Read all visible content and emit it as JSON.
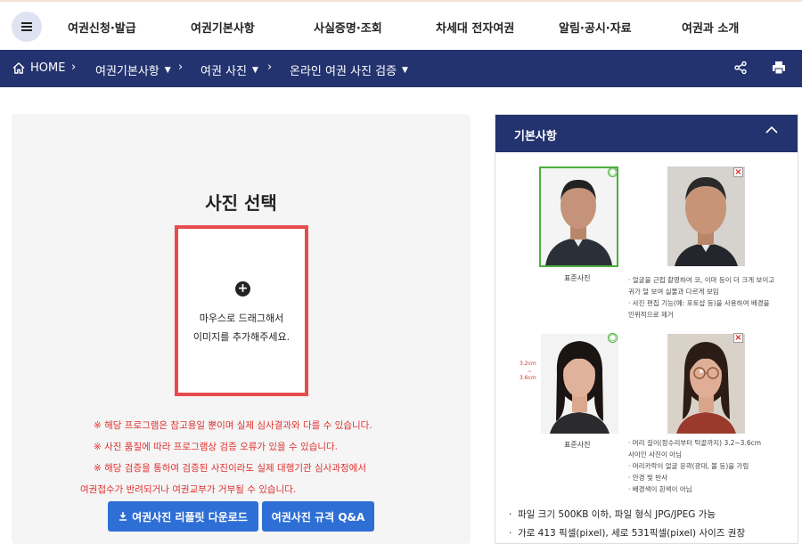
{
  "nav": {
    "menu_icon": "hamburger-icon",
    "items": [
      "여권신청·발급",
      "여권기본사항",
      "사실증명·조회",
      "차세대 전자여권",
      "알림·공시·자료",
      "여권과 소개"
    ]
  },
  "breadcrumb": {
    "home": "HOME",
    "level1": "여권기본사항",
    "level2": "여권 사진",
    "level3": "온라인 여권 사진 검증",
    "share_icon": "share-icon",
    "print_icon": "print-icon"
  },
  "upload": {
    "title": "사진 선택",
    "drop_line1": "마우스로 드래그해서",
    "drop_line2": "이미지를 추가해주세요.",
    "notes": [
      "※ 해당 프로그램은 참고용일 뿐이며 실제 심사결과와 다를 수 있습니다.",
      "※ 사진 품질에 따라 프로그램상 검증 오류가 있을 수 있습니다.",
      "※ 해당 검증을 통하여 검증된 사진이라도 실제 대행기관 심사과정에서",
      "여권접수가 반려되거나 여권교부가 거부될 수 있습니다."
    ],
    "btn_download": "여권사진 리플릿 다운로드",
    "btn_qa": "여권사진 규격 Q&A"
  },
  "basics": {
    "title": "기본사항",
    "caption_standard": "표준사진",
    "desc1": [
      "· 얼굴을 근접 촬영하여 코, 이마 등이 더 크게 보이고",
      "  귀가 덜 보여 실물과 다르게 보임",
      "· 사진 편집 기능(예: 포토샵 등)을 사용하여 배경을",
      "  인위적으로 제거"
    ],
    "desc2": [
      "· 머리 길이(정수리부터 턱끝까지) 3.2~3.6cm",
      "  사이인 사진이 아님",
      "· 머리카락이 얼굴 윤곽(광대, 볼 등)을 가림",
      "· 안경 빛 반사",
      "· 배경색이 흰색이 아님"
    ],
    "dim_top": "3.2cm",
    "dim_sep": "~",
    "dim_bottom": "3.6cm",
    "bullets": [
      "파일 크기 500KB 이하, 파일 형식 JPG/JPEG 가능",
      "가로 413 픽셀(pixel), 세로 531픽셀(pixel) 사이즈 권장"
    ]
  },
  "colors": {
    "navy": "#23336f",
    "accent_blue": "#2e6fd6",
    "warning_red": "#e03030",
    "ok_green": "#4caf3c"
  }
}
